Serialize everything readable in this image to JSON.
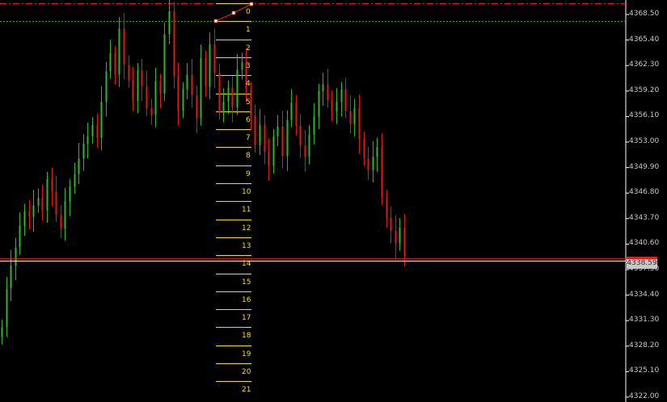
{
  "chart_data": {
    "type": "candlestick",
    "yaxis_ticks": [
      "4368.50",
      "4365.40",
      "4362.30",
      "4359.20",
      "4356.10",
      "4353.00",
      "4349.90",
      "4346.80",
      "4343.70",
      "4340.60",
      "4337.50",
      "4334.40",
      "4331.30",
      "4328.20",
      "4325.10",
      "4322.00"
    ],
    "ylim": [
      4321.6,
      4370.0
    ],
    "current_price": "4338.59",
    "fib_levels": [
      "0",
      "1",
      "2",
      "3",
      "4",
      "5",
      "6",
      "7",
      "8",
      "9",
      "10",
      "11",
      "12",
      "13",
      "14",
      "15",
      "16",
      "17",
      "18",
      "19",
      "20",
      "21"
    ],
    "colors": {
      "up": "#2fb52f",
      "down": "#e01818",
      "fib": "#f0e000",
      "grid": "#ffffff",
      "hline_top": "#e02020",
      "hline_green": "#1f9f1f"
    },
    "close_series": [
      4330.5,
      4335.2,
      4338.0,
      4340.2,
      4342.8,
      4344.6,
      4343.9,
      4345.3,
      4346.2,
      4344.7,
      4348.5,
      4347.0,
      4344.2,
      4342.5,
      4345.8,
      4347.6,
      4349.1,
      4351.0,
      4352.8,
      4353.7,
      4355.1,
      4353.5,
      4357.9,
      4361.6,
      4363.8,
      4361.2,
      4366.8,
      4362.4,
      4360.5,
      4358.0,
      4361.7,
      4359.8,
      4357.1,
      4356.3,
      4360.4,
      4358.9,
      4366.1,
      4368.9,
      4361.0,
      4356.8,
      4359.4,
      4361.2,
      4358.7,
      4355.9,
      4363.2,
      4359.7,
      4364.9,
      4361.4,
      4356.6,
      4357.9,
      4359.6,
      4357.2,
      4361.8,
      4362.7,
      4359.4,
      4356.2,
      4352.6,
      4355.1,
      4351.8,
      4350.1,
      4353.7,
      4354.9,
      4351.3,
      4355.7,
      4357.8,
      4355.0,
      4352.6,
      4351.2,
      4353.9,
      4356.1,
      4359.2,
      4360.0,
      4358.1,
      4356.7,
      4357.9,
      4359.4,
      4356.8,
      4355.2,
      4357.1,
      4353.4,
      4351.0,
      4349.6,
      4351.2,
      4352.4,
      4346.3,
      4343.8,
      4342.2,
      4340.7,
      4342.6,
      4339.1
    ]
  }
}
